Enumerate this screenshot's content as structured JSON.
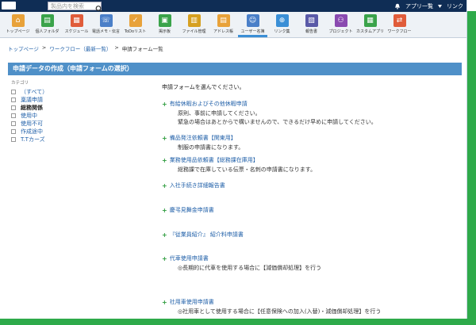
{
  "topbar": {
    "search_placeholder": "製品内を検索",
    "right_links": [
      "アプリ一覧",
      "リンク"
    ]
  },
  "toolbar": {
    "items": [
      {
        "label": "トップページ",
        "icon": "home-icon",
        "color": "#e8a23a"
      },
      {
        "label": "個人フォルダ",
        "icon": "folder-icon",
        "color": "#3aa34a"
      },
      {
        "label": "スケジュール",
        "icon": "calendar-icon",
        "color": "#e05c3a"
      },
      {
        "label": "電話メモ・伝言",
        "icon": "phone-memo-icon",
        "color": "#4a7fc8"
      },
      {
        "label": "ToDoリスト",
        "icon": "todo-icon",
        "color": "#e8a23a"
      },
      {
        "label": "掲示板",
        "icon": "bulletin-icon",
        "color": "#3aa34a"
      },
      {
        "label": "ファイル管理",
        "icon": "file-icon",
        "color": "#d6a020"
      },
      {
        "label": "アドレス帳",
        "icon": "address-book-icon",
        "color": "#e8a23a"
      },
      {
        "label": "ユーザー名簿",
        "icon": "users-icon",
        "color": "#4a7fc8"
      },
      {
        "label": "リンク集",
        "icon": "link-icon",
        "color": "#3a8fd6"
      },
      {
        "label": "報告書",
        "icon": "report-icon",
        "color": "#5a5aa8"
      },
      {
        "label": "プロジェクト",
        "icon": "project-icon",
        "color": "#8a4ab0"
      },
      {
        "label": "カスタムアプリ",
        "icon": "custom-app-icon",
        "color": "#3aa34a"
      },
      {
        "label": "ワークフロー",
        "icon": "workflow-icon",
        "color": "#e05c3a"
      }
    ]
  },
  "breadcrumb": [
    "トップページ",
    "ワークフロー（最新一覧）",
    "申請フォーム一覧"
  ],
  "page_title": "申請データの作成（申請フォームの選択）",
  "sidebar": {
    "title": "カテゴリ",
    "items": [
      {
        "label": "（すべて）",
        "active": false
      },
      {
        "label": "稟議申請",
        "active": false
      },
      {
        "label": "総務関係",
        "active": true
      },
      {
        "label": "使用中",
        "active": false
      },
      {
        "label": "使用不可",
        "active": false
      },
      {
        "label": "作成途中",
        "active": false
      },
      {
        "label": "T.Tカーズ",
        "active": false
      }
    ]
  },
  "main": {
    "intro": "申請フォームを選んでください。",
    "forms": [
      {
        "title": "有給休暇およびその他休暇申請",
        "desc": [
          "原則、事前に申請してください。",
          "緊急の場合はあとからで構いませんので、できるだけ早めに申請してください。"
        ]
      },
      {
        "title": "備品発注依頼書【関東用】",
        "desc": [
          "制服の申請書になります。"
        ]
      },
      {
        "title": "業務使用品依頼書【総務課在庫用】",
        "desc": [
          "総務課で在庫している伝票・名刺の申請書になります。"
        ]
      },
      {
        "title": "入社手続き詳細報告書",
        "desc": []
      },
      {
        "title": "慶弔見舞金申請書",
        "desc": []
      },
      {
        "title": "『従業員紹介』 紹介料申請書",
        "desc": []
      },
      {
        "title": "代車使用申請書",
        "desc": [
          "◎長期的に代車を使用する場合に【減価償却処理】を行う"
        ]
      },
      {
        "title": "社用車使用申請書",
        "desc": [
          "◎社用車として使用する場合に【任意保険への加入(入替)・減価償却処理】を行う"
        ]
      }
    ]
  }
}
